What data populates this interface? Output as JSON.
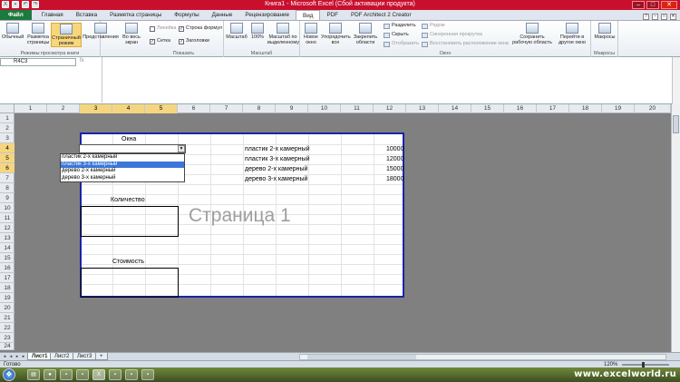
{
  "window": {
    "title": "Книга1 - Microsoft Excel (Сбой активации продукта)",
    "controls": [
      "–",
      "□",
      "✕"
    ]
  },
  "tabs": [
    {
      "label": "Файл",
      "kind": "file"
    },
    {
      "label": "Главная"
    },
    {
      "label": "Вставка"
    },
    {
      "label": "Разметка страницы"
    },
    {
      "label": "Формулы"
    },
    {
      "label": "Данные"
    },
    {
      "label": "Рецензирование"
    },
    {
      "label": "Вид",
      "active": true
    },
    {
      "label": "PDF"
    },
    {
      "label": "PDF Architect 2 Creator"
    }
  ],
  "ribbon": {
    "views": {
      "label": "Режимы просмотра книги",
      "normal": "Обычный",
      "page_layout": "Разметка страницы",
      "page_break": "Страничный режим",
      "views": "Представления",
      "fullscreen": "Во весь экран"
    },
    "show": {
      "label": "Показать",
      "ruler": "Линейка",
      "grid": "Сетка",
      "formula_bar": "Строка формул",
      "headings": "Заголовки"
    },
    "zoom": {
      "label": "Масштаб",
      "zoom": "Масштаб",
      "hundred": "100%",
      "selection": "Масштаб по выделенному"
    },
    "window": {
      "label": "Окно",
      "new": "Новое окно",
      "arrange": "Упорядочить все",
      "freeze": "Закрепить области",
      "split": "Разделить",
      "hide": "Скрыть",
      "unhide": "Отобразить",
      "side": "Рядом",
      "sync": "Синхронная прокрутка",
      "reset": "Восстановить расположение окна",
      "save_ws": "Сохранить рабочую область",
      "switch": "Перейти в другое окно"
    },
    "macros": {
      "label": "Макросы",
      "macros": "Макросы"
    }
  },
  "formula_bar": {
    "name_box": "R4C3",
    "fx": "fx",
    "value": ""
  },
  "columns": [
    "1",
    "2",
    "3",
    "4",
    "5",
    "6",
    "7",
    "8",
    "9",
    "10",
    "11",
    "12",
    "13",
    "14",
    "15",
    "16",
    "17",
    "18",
    "19",
    "20"
  ],
  "rows": [
    "1",
    "2",
    "3",
    "4",
    "5",
    "6",
    "7",
    "8",
    "9",
    "10",
    "11",
    "12",
    "13",
    "14",
    "15",
    "16",
    "17",
    "18",
    "19",
    "20",
    "21",
    "22",
    "23",
    "24"
  ],
  "sheet": {
    "title_windows": "Окна",
    "title_qty": "Количество",
    "title_cost": "Стоимость",
    "watermark": "Страница 1",
    "price_items": [
      {
        "name": "пластик 2-х камерный",
        "price": "10000"
      },
      {
        "name": "пластик 3-х камерный",
        "price": "12000"
      },
      {
        "name": "дерево 2-х камерный",
        "price": "15000"
      },
      {
        "name": "дерево 3-х камерный",
        "price": "18000"
      }
    ]
  },
  "dropdown": {
    "options": [
      "пластик 2-х камерный",
      "пластик 3-х камерный",
      "дерево 2-х камерный",
      "дерево 3-х камерный"
    ],
    "highlighted_index": 1
  },
  "sheet_tabs": [
    "Лист1",
    "Лист2",
    "Лист3"
  ],
  "status": {
    "ready": "Готово",
    "zoom": "120%"
  },
  "taskbar": {
    "site": "www.excelworld.ru"
  }
}
